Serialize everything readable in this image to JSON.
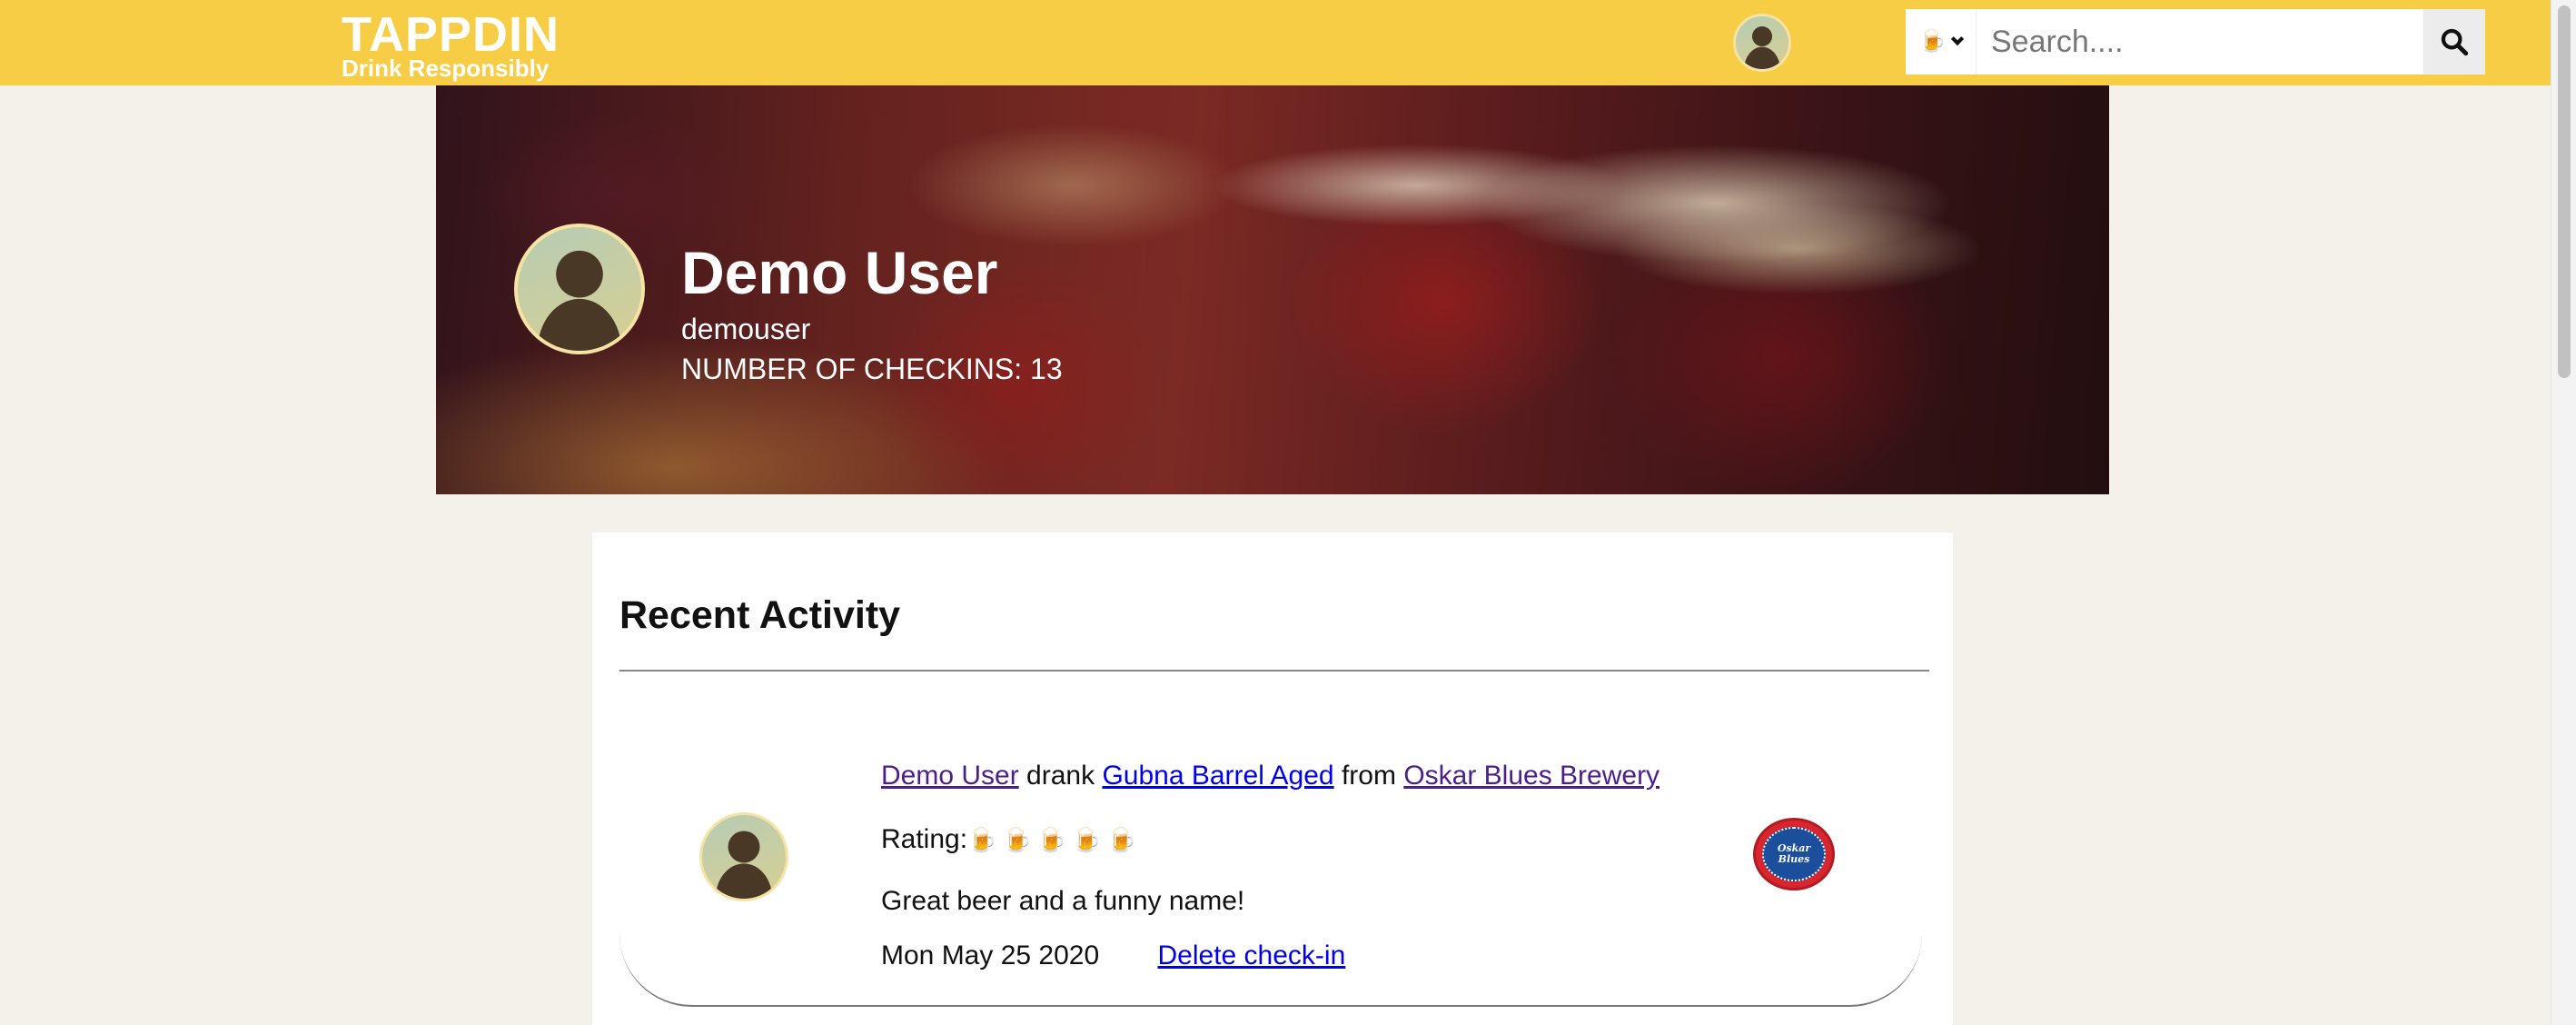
{
  "navbar": {
    "logo_title": "TAPPDIN",
    "logo_tagline": "Drink Responsibly",
    "search": {
      "category_icon": "🍺",
      "placeholder": "Search...."
    },
    "search_button_icon": "search-icon"
  },
  "profile": {
    "name": "Demo User",
    "username": "demouser",
    "checkins": "NUMBER OF CHECKINS: 13"
  },
  "recent_activity": {
    "title": "Recent Activity",
    "items": [
      {
        "user": "Demo User",
        "verb": "drank",
        "beer": "Gubna Barrel Aged",
        "preposition": "from",
        "brewery": "Oskar Blues Brewery",
        "rating_label": "Rating:",
        "rating_mugs": [
          "🍺",
          "🍺",
          "🍺",
          "🍺",
          "🍺"
        ],
        "comment": "Great beer and a funny name!",
        "date": "Mon May 25 2020",
        "delete_label": "Delete check-in",
        "brewery_logo_text": "Oskar Blues"
      }
    ]
  },
  "colors": {
    "navbar": "#f8cd46",
    "page_background": "#f4f1ea",
    "visited_link": "#4c1f8c",
    "link": "#0000ee",
    "avatar_silhouette": "#4a3826"
  }
}
